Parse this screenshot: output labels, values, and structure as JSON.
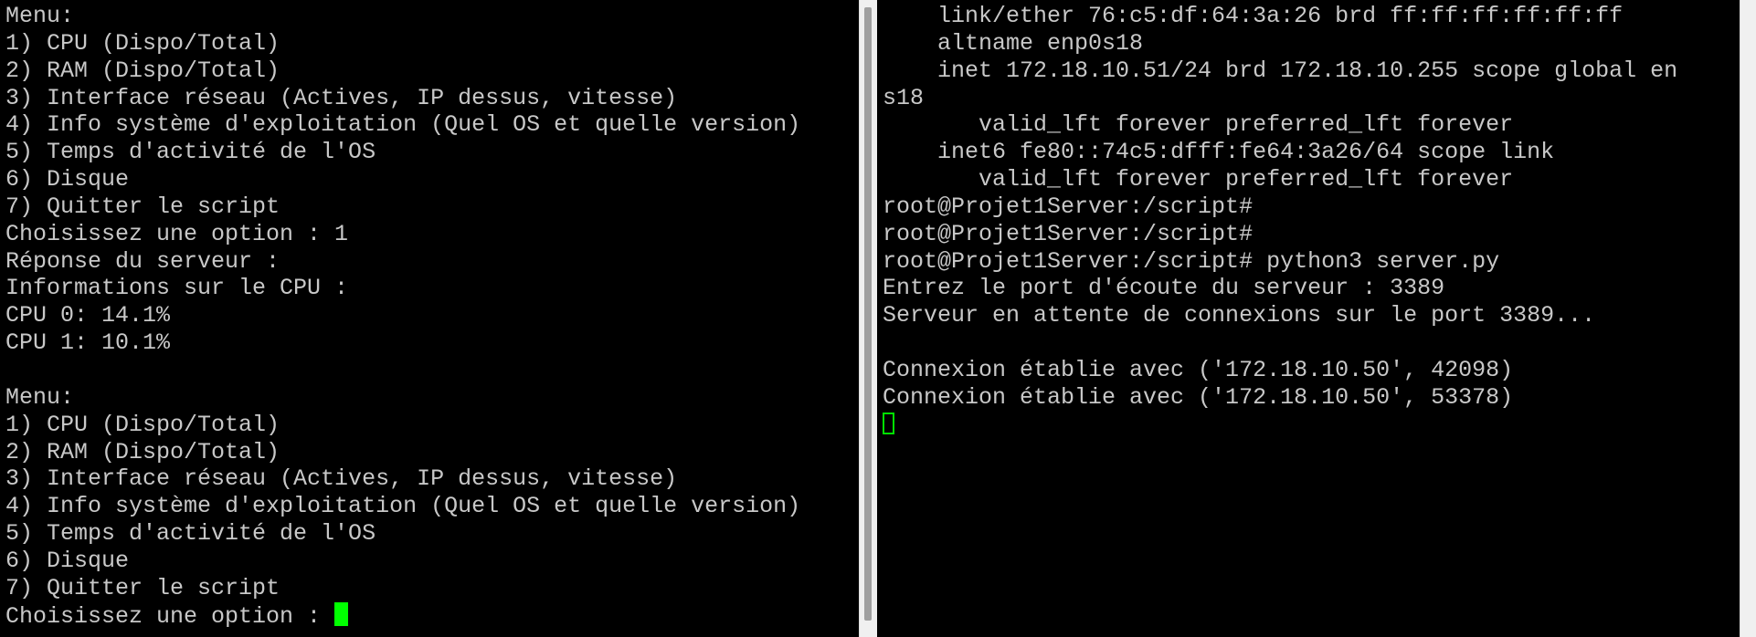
{
  "left_terminal": {
    "lines": [
      "Menu:",
      "1) CPU (Dispo/Total)",
      "2) RAM (Dispo/Total)",
      "3) Interface réseau (Actives, IP dessus, vitesse)",
      "4) Info système d'exploitation (Quel OS et quelle version)",
      "5) Temps d'activité de l'OS",
      "6) Disque",
      "7) Quitter le script",
      "Choisissez une option : 1",
      "Réponse du serveur :",
      "Informations sur le CPU :",
      "CPU 0: 14.1%",
      "CPU 1: 10.1%",
      "",
      "Menu:",
      "1) CPU (Dispo/Total)",
      "2) RAM (Dispo/Total)",
      "3) Interface réseau (Actives, IP dessus, vitesse)",
      "4) Info système d'exploitation (Quel OS et quelle version)",
      "5) Temps d'activité de l'OS",
      "6) Disque",
      "7) Quitter le script"
    ],
    "prompt_line": "Choisissez une option : "
  },
  "right_terminal": {
    "lines": [
      "    link/ether 76:c5:df:64:3a:26 brd ff:ff:ff:ff:ff:ff",
      "    altname enp0s18",
      "    inet 172.18.10.51/24 brd 172.18.10.255 scope global en",
      "s18",
      "       valid_lft forever preferred_lft forever",
      "    inet6 fe80::74c5:dfff:fe64:3a26/64 scope link",
      "       valid_lft forever preferred_lft forever",
      "root@Projet1Server:/script#",
      "root@Projet1Server:/script#",
      "root@Projet1Server:/script# python3 server.py",
      "Entrez le port d'écoute du serveur : 3389",
      "Serveur en attente de connexions sur le port 3389...",
      "",
      "Connexion établie avec ('172.18.10.50', 42098)",
      "Connexion établie avec ('172.18.10.50', 53378)"
    ]
  },
  "colors": {
    "background": "#000000",
    "text": "#c8c8c8",
    "cursor": "#00ff00"
  }
}
